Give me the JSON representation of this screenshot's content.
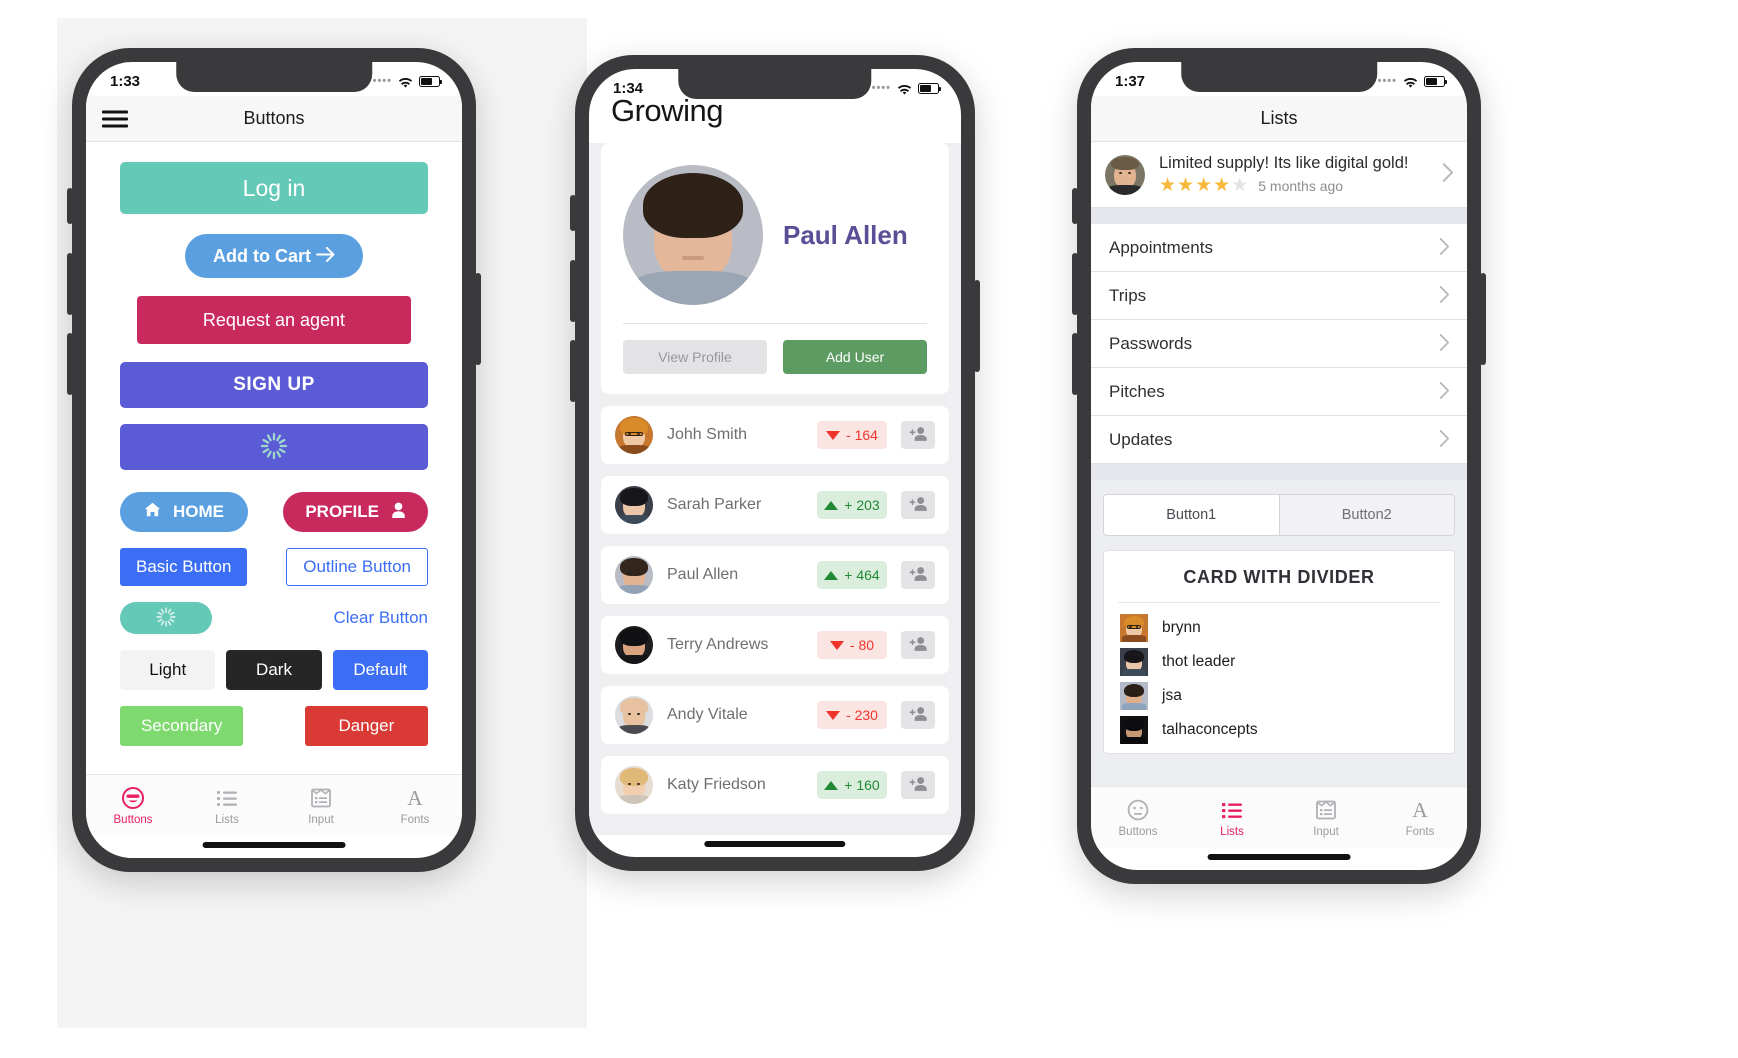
{
  "phone1": {
    "status": {
      "time": "1:33"
    },
    "navbar": {
      "title": "Buttons",
      "menu_icon": "hamburger-icon"
    },
    "buttons": {
      "login": "Log in",
      "add_to_cart": "Add to Cart",
      "cart_icon": "arrow-right-icon",
      "request_agent": "Request an agent",
      "sign_up": "SIGN UP",
      "loading": "",
      "home": "HOME",
      "home_icon": "home-icon",
      "profile": "PROFILE",
      "profile_icon": "person-icon",
      "basic": "Basic Button",
      "outline": "Outline Button",
      "spinner": "",
      "clear": "Clear Button",
      "light": "Light",
      "dark": "Dark",
      "default": "Default",
      "secondary": "Secondary",
      "danger": "Danger"
    },
    "colors": {
      "login": "#65c9b7",
      "cart": "#5a9fe0",
      "agent": "#c92a5e",
      "signup": "#5b5bd6",
      "basic": "#3b6ef4",
      "secondary": "#7ed96f",
      "danger": "#d93a35",
      "dark": "#262626",
      "light": "#f3f3f4",
      "accent": "#e91e63"
    },
    "tabs": [
      {
        "label": "Buttons",
        "icon": "smiley-sunglasses-icon",
        "active": true
      },
      {
        "label": "Lists",
        "icon": "list-icon",
        "active": false
      },
      {
        "label": "Input",
        "icon": "input-form-icon",
        "active": false
      },
      {
        "label": "Fonts",
        "icon": "font-a-icon",
        "active": false
      }
    ]
  },
  "phone2": {
    "status": {
      "time": "1:34"
    },
    "title": "Growing",
    "profile_card": {
      "name": "Paul Allen",
      "avatar": "paul-allen-photo",
      "view_profile": "View Profile",
      "add_user": "Add User"
    },
    "users": [
      {
        "name": "Johh Smith",
        "delta": "- 164",
        "dir": "down",
        "avatar": "woman-glasses-photo",
        "action_icon": "person-add-icon"
      },
      {
        "name": "Sarah Parker",
        "delta": "+ 203",
        "dir": "up",
        "avatar": "woman-dark-hair-photo",
        "action_icon": "person-add-icon"
      },
      {
        "name": "Paul Allen",
        "delta": "+ 464",
        "dir": "up",
        "avatar": "paul-allen-photo",
        "action_icon": "person-add-icon"
      },
      {
        "name": "Terry Andrews",
        "delta": "- 80",
        "dir": "down",
        "avatar": "man-dark-photo",
        "action_icon": "person-add-icon"
      },
      {
        "name": "Andy Vitale",
        "delta": "- 230",
        "dir": "down",
        "avatar": "bald-man-photo",
        "action_icon": "person-add-icon"
      },
      {
        "name": "Katy Friedson",
        "delta": "+ 160",
        "dir": "up",
        "avatar": "blonde-woman-photo",
        "action_icon": "person-add-icon"
      }
    ],
    "colors": {
      "name": "#5b4e96",
      "add_user": "#5c9c62",
      "up": "#1f8a33",
      "down": "#f0342b"
    }
  },
  "phone3": {
    "status": {
      "time": "1:37"
    },
    "navbar": {
      "title": "Lists"
    },
    "review": {
      "title": "Limited supply! Its like digital gold!",
      "time": "5 months ago",
      "stars_filled": 4,
      "stars_total": 5,
      "avatar": "smiling-man-photo",
      "chevron": "chevron-right-icon"
    },
    "list_items": [
      {
        "label": "Appointments",
        "chevron": "chevron-right-icon"
      },
      {
        "label": "Trips",
        "chevron": "chevron-right-icon"
      },
      {
        "label": "Passwords",
        "chevron": "chevron-right-icon"
      },
      {
        "label": "Pitches",
        "chevron": "chevron-right-icon"
      },
      {
        "label": "Updates",
        "chevron": "chevron-right-icon"
      }
    ],
    "segment": [
      {
        "label": "Button1",
        "active": true
      },
      {
        "label": "Button2",
        "active": false
      }
    ],
    "card": {
      "title": "CARD WITH DIVIDER",
      "rows": [
        {
          "name": "brynn",
          "thumb": "woman-glasses-photo"
        },
        {
          "name": "thot leader",
          "thumb": "woman-dark-hair-photo"
        },
        {
          "name": "jsa",
          "thumb": "man-blue-shirt-photo"
        },
        {
          "name": "talhaconcepts",
          "thumb": "man-black-photo"
        }
      ]
    },
    "tabs": [
      {
        "label": "Buttons",
        "icon": "smiley-neutral-icon",
        "active": false
      },
      {
        "label": "Lists",
        "icon": "list-icon",
        "active": true
      },
      {
        "label": "Input",
        "icon": "input-form-icon",
        "active": false
      },
      {
        "label": "Fonts",
        "icon": "font-a-icon",
        "active": false
      }
    ]
  }
}
